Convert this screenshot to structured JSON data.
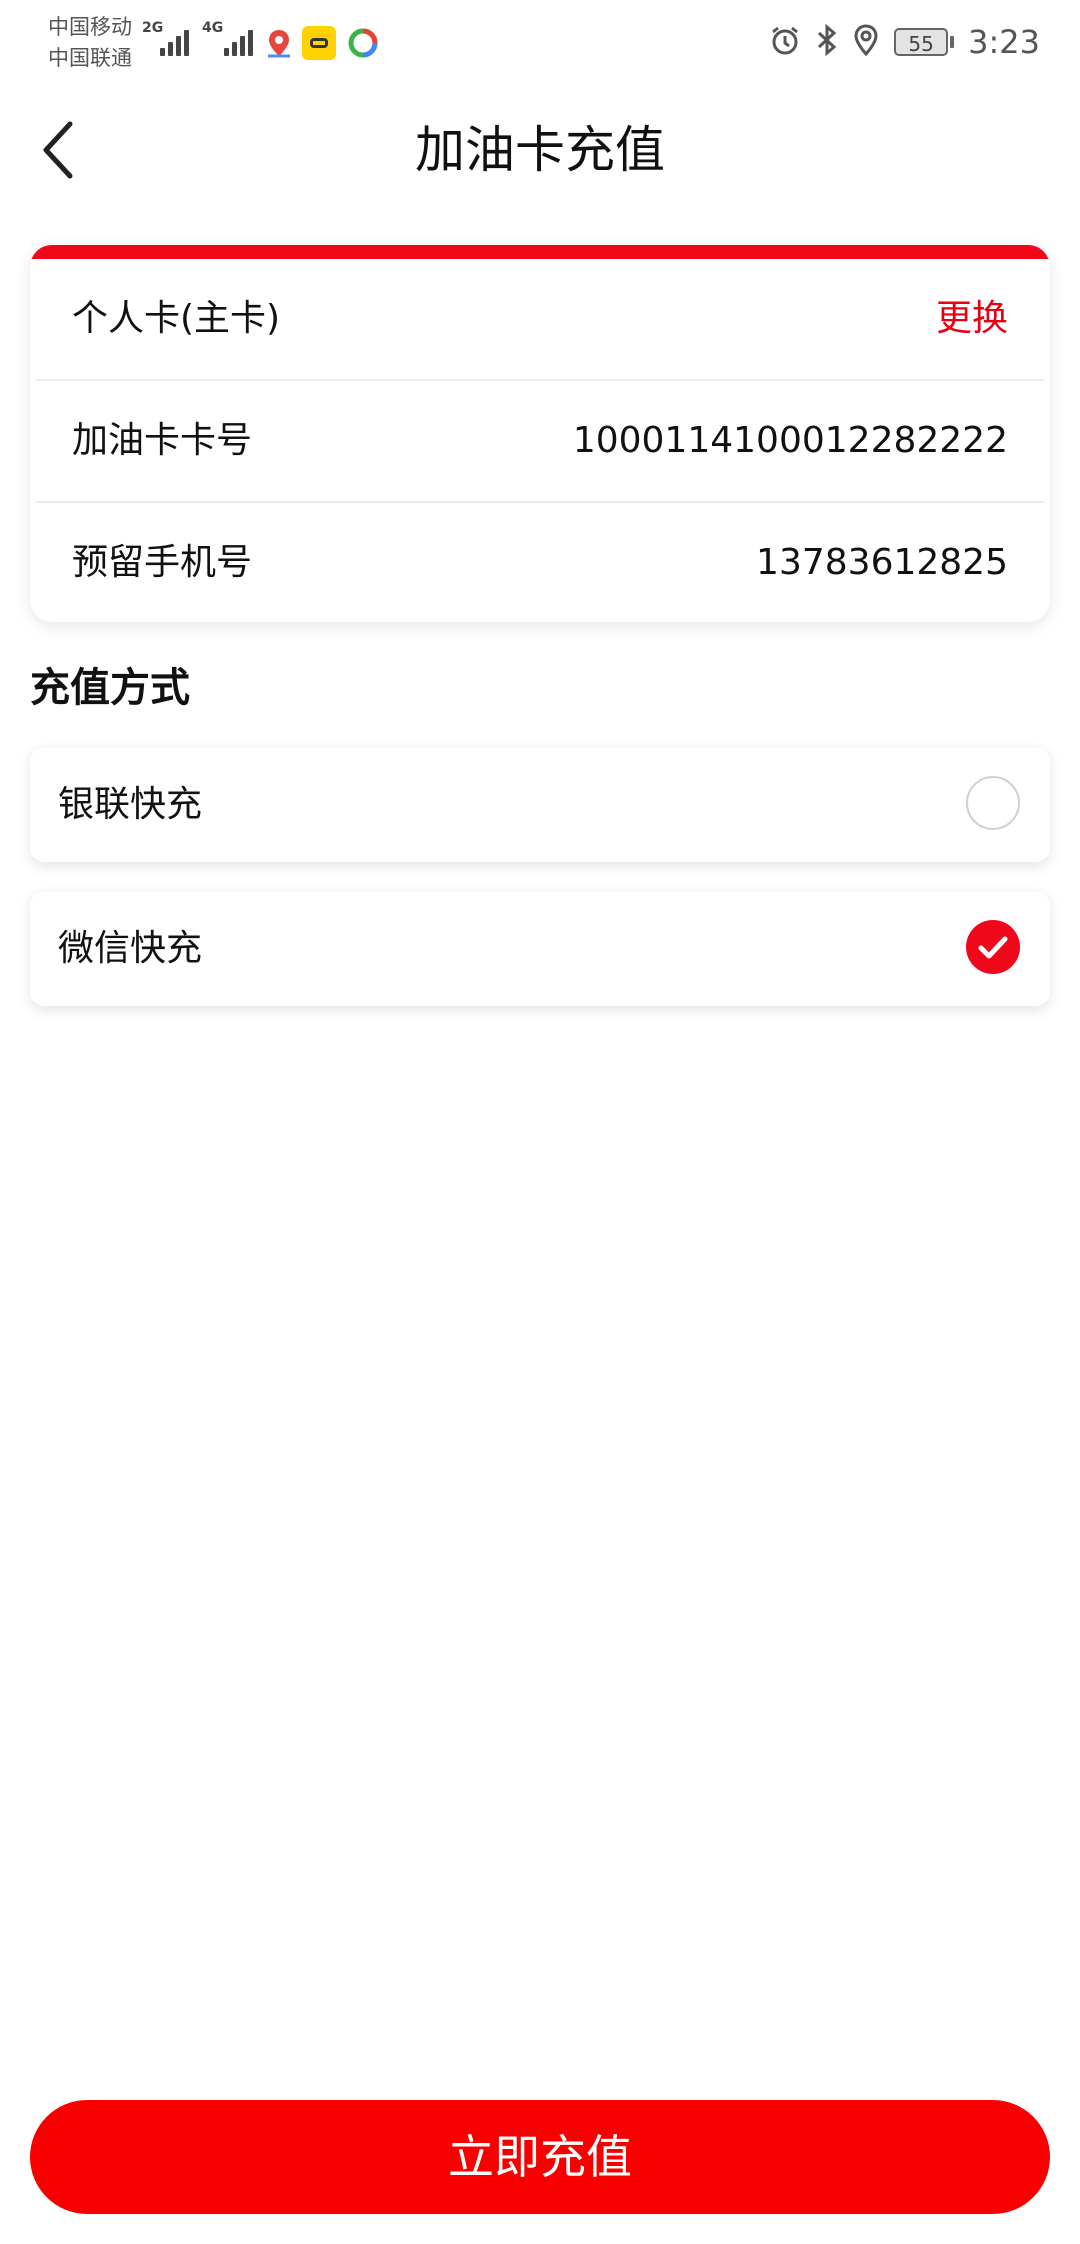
{
  "status_bar": {
    "carrier_1": "中国移动",
    "carrier_2": "中国联通",
    "network_1": "2G",
    "network_2": "4G",
    "battery": "55",
    "time": "3:23"
  },
  "nav": {
    "title": "加油卡充值",
    "back_icon": "chevron-left-icon"
  },
  "card_info": {
    "accent_color": "#f0071a",
    "card_type": "个人卡(主卡)",
    "change_label": "更换",
    "card_number_label": "加油卡卡号",
    "card_number": "1000114100012282222",
    "phone_label": "预留手机号",
    "phone": "13783612825"
  },
  "recharge": {
    "section_title": "充值方式",
    "options": [
      {
        "label": "银联快充",
        "selected": false
      },
      {
        "label": "微信快充",
        "selected": true
      }
    ]
  },
  "submit_label": "立即充值",
  "colors": {
    "brand_red": "#f90000"
  }
}
